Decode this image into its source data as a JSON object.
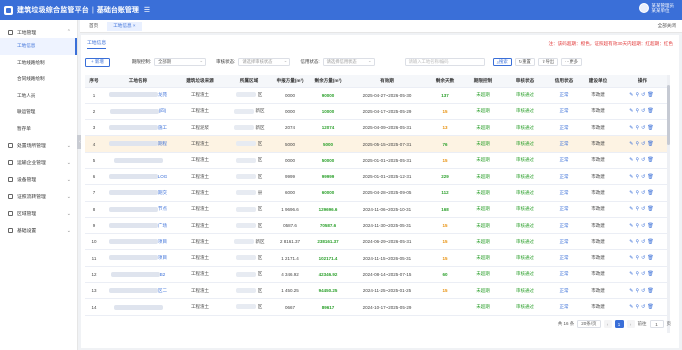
{
  "header": {
    "title": "建筑垃圾综合监管平台",
    "separator": "|",
    "subtitle": "基础台账管理",
    "menu_icon": "menu-icon",
    "user_line1": "某某管理员",
    "user_line2": "某某单位"
  },
  "sidebar": {
    "groups": [
      {
        "label": "工地管理",
        "expanded": true,
        "children": [
          "工地信息",
          "工地线路绘制",
          "合同线路绘制",
          "工地人员",
          "联运管理",
          "暂存单"
        ]
      },
      {
        "label": "处置场所管理",
        "expanded": false
      },
      {
        "label": "运输企业管理",
        "expanded": false
      },
      {
        "label": "设备管理",
        "expanded": false
      },
      {
        "label": "证照流转管理",
        "expanded": false
      },
      {
        "label": "区域管理",
        "expanded": false
      },
      {
        "label": "基础设置",
        "expanded": false
      }
    ],
    "active_child": "工地信息"
  },
  "tabs": {
    "items": [
      "首页",
      "工地信息 ×"
    ],
    "active": 1,
    "close_all": "全部关闭"
  },
  "subtab": "工地信息",
  "note": "注：该码超期：橙色，证照超有效30天内超期：红超期：红色",
  "filters": {
    "add_label": "+ 新增",
    "f1_label": "期限控制:",
    "f1_value": "全部期",
    "f2_label": "审核状态:",
    "f2_placeholder": "请选择审核状态",
    "f3_label": "信用状态:",
    "f3_placeholder": "请选择信用状态",
    "search_placeholder": "请输入工地名称/编码",
    "search_btn": "搜索",
    "reset_btn": "重置",
    "export_btn": "导出",
    "more_btn": "更多"
  },
  "table": {
    "headers": [
      "序号",
      "工地名称",
      "建筑垃圾来源",
      "所属区域",
      "申报方量(m³)",
      "剩余方量(m³)",
      "有效期",
      "剩余天数",
      "期限控制",
      "审核状态",
      "信用状态",
      "建设单位",
      "操作"
    ],
    "rows": [
      {
        "no": "1",
        "name_tail": "龙苑",
        "type": "工程渣土",
        "area": "区",
        "declared": "0000",
        "remain": "90000",
        "period": "2025-04-27~2026-05-30",
        "days": "137",
        "days_color": "g",
        "limit": "未超期",
        "audit": "审核通过",
        "credit": "正常",
        "builder": "市政建",
        "hl": false
      },
      {
        "no": "2",
        "name_tail": "(四)",
        "type": "工程渣土",
        "area": "新区",
        "declared": "0000",
        "remain": "10000",
        "period": "2025-04-17~2025-05-29",
        "days": "15",
        "days_color": "o",
        "limit": "未超期",
        "audit": "审核通过",
        "credit": "正常",
        "builder": "市政建",
        "hl": false
      },
      {
        "no": "3",
        "name_tail": "施工",
        "type": "工程泥浆",
        "area": "新区",
        "declared": "2074",
        "remain": "12074",
        "period": "2025-04-09~2026-05-31",
        "days": "13",
        "days_color": "o",
        "limit": "未超期",
        "audit": "审核通过",
        "credit": "正常",
        "builder": "市政建",
        "hl": false
      },
      {
        "no": "4",
        "name_tail": "期程",
        "type": "工程渣土",
        "area": "区",
        "declared": "5000",
        "remain": "5000",
        "period": "2025-05-15~2025-07-31",
        "days": "76",
        "days_color": "g",
        "limit": "未超期",
        "audit": "审核通过",
        "credit": "正常",
        "builder": "市政建",
        "hl": true
      },
      {
        "no": "5",
        "name_tail": "",
        "type": "工程渣土",
        "area": "区",
        "declared": "0000",
        "remain": "50000",
        "period": "2025-01-01~2025-05-31",
        "days": "15",
        "days_color": "o",
        "limit": "未超期",
        "audit": "审核通过",
        "credit": "正常",
        "builder": "市政建",
        "hl": false
      },
      {
        "no": "6",
        "name_tail": "LOG",
        "type": "工程渣土",
        "area": "区",
        "declared": "9999",
        "remain": "99999",
        "period": "2025-01-01~2025-12-31",
        "days": "229",
        "days_color": "g",
        "limit": "未超期",
        "audit": "审核通过",
        "credit": "正常",
        "builder": "市政建",
        "hl": false
      },
      {
        "no": "7",
        "name_tail": "期交",
        "type": "工程渣土",
        "area": "县",
        "declared": "6000",
        "remain": "60000",
        "period": "2025-04-28~2025-09-05",
        "days": "112",
        "days_color": "g",
        "limit": "未超期",
        "audit": "审核通过",
        "credit": "正常",
        "builder": "市政建",
        "hl": false
      },
      {
        "no": "8",
        "name_tail": "节点",
        "type": "工程渣土",
        "area": "区",
        "declared": "1 9696.6",
        "remain": "129696.6",
        "period": "2024-11-06~2025-10-31",
        "days": "168",
        "days_color": "g",
        "limit": "未超期",
        "audit": "审核通过",
        "credit": "正常",
        "builder": "市政建",
        "hl": false
      },
      {
        "no": "9",
        "name_tail": "广场",
        "type": "工程渣土",
        "area": "区",
        "declared": "0587.6",
        "remain": "70587.6",
        "period": "2024-11-30~2025-05-31",
        "days": "15",
        "days_color": "o",
        "limit": "未超期",
        "audit": "审核通过",
        "credit": "正常",
        "builder": "市政建",
        "hl": false
      },
      {
        "no": "10",
        "name_tail": "项目",
        "type": "工程渣土",
        "area": "新区",
        "declared": "2 8161.37",
        "remain": "238161.37",
        "period": "2024-06-29~2026-05-31",
        "days": "15",
        "days_color": "o",
        "limit": "未超期",
        "audit": "审核通过",
        "credit": "正常",
        "builder": "市政建",
        "hl": false
      },
      {
        "no": "11",
        "name_tail": "项目",
        "type": "工程渣土",
        "area": "区",
        "declared": "1 2171.4",
        "remain": "102171.4",
        "period": "2024-11-15~2026-05-31",
        "days": "15",
        "days_color": "o",
        "limit": "未超期",
        "audit": "审核通过",
        "credit": "正常",
        "builder": "市政建",
        "hl": false
      },
      {
        "no": "12",
        "name_tail": "B2",
        "type": "工程渣土",
        "area": "区",
        "declared": "4 346.92",
        "remain": "42346.92",
        "period": "2024-08-14~2025-07-15",
        "days": "60",
        "days_color": "g",
        "limit": "未超期",
        "audit": "审核通过",
        "credit": "正常",
        "builder": "市政建",
        "hl": false
      },
      {
        "no": "13",
        "name_tail": "区二",
        "type": "工程渣土",
        "area": "区",
        "declared": "1 450.25",
        "remain": "94450.25",
        "period": "2024-11-25~2025-01-25",
        "days": "15",
        "days_color": "o",
        "limit": "未超期",
        "audit": "审核通过",
        "credit": "正常",
        "builder": "市政建",
        "hl": false
      },
      {
        "no": "14",
        "name_tail": "",
        "type": "工程渣土",
        "area": "区",
        "declared": "0667",
        "remain": "89617",
        "period": "2024-10-17~2025-05-29",
        "days": "",
        "days_color": "g",
        "limit": "未超期",
        "audit": "审核通过",
        "credit": "正常",
        "builder": "市政建",
        "hl": false
      }
    ],
    "op_icons": [
      "edit-icon",
      "link-icon",
      "history-icon",
      "delete-icon"
    ]
  },
  "pager": {
    "total": "共 16 条",
    "size": "20条/页",
    "current": "1",
    "goto_label": "前往",
    "goto_value": "1",
    "page_unit": "页"
  }
}
